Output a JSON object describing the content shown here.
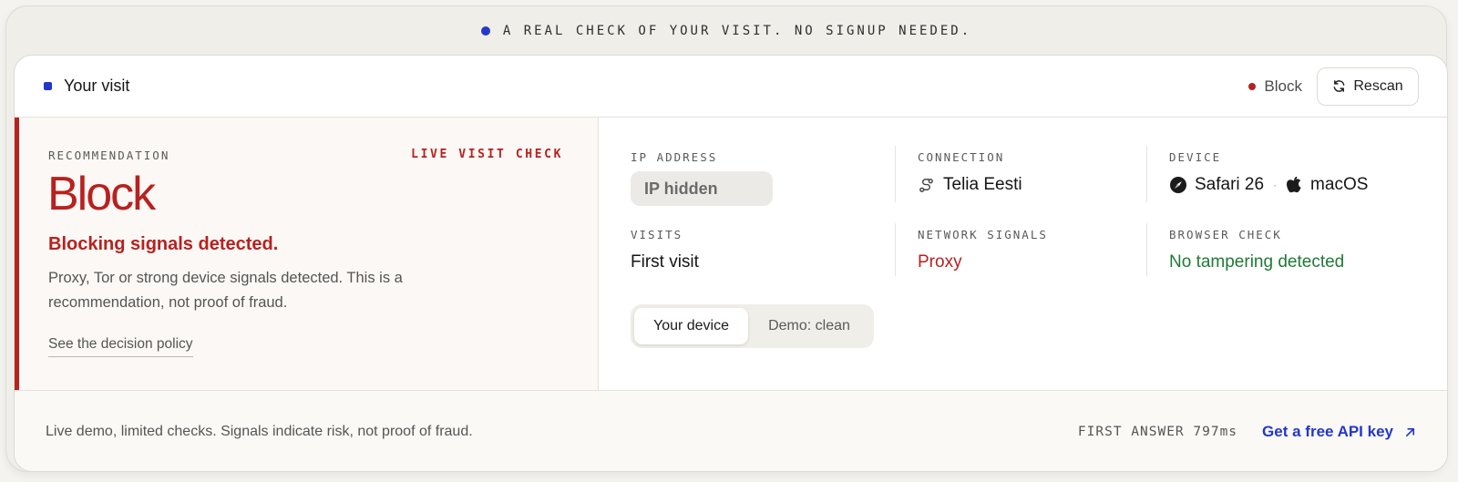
{
  "banner": {
    "text": "A REAL CHECK OF YOUR VISIT. NO SIGNUP NEEDED."
  },
  "header": {
    "title": "Your visit",
    "status_label": "Block",
    "rescan_label": "Rescan"
  },
  "recommendation": {
    "label": "RECOMMENDATION",
    "badge": "LIVE VISIT CHECK",
    "verdict": "Block",
    "headline": "Blocking signals detected.",
    "description": "Proxy, Tor or strong device signals detected. This is a recommendation, not proof of fraud.",
    "policy_link": "See the decision policy"
  },
  "details": {
    "ip": {
      "label": "IP ADDRESS",
      "value": "IP hidden"
    },
    "connection": {
      "label": "CONNECTION",
      "value": "Telia Eesti"
    },
    "device": {
      "label": "DEVICE",
      "browser": "Safari 26",
      "separator": "·",
      "os": "macOS"
    },
    "visits": {
      "label": "VISITS",
      "value": "First visit"
    },
    "network": {
      "label": "NETWORK SIGNALS",
      "value": "Proxy"
    },
    "browser_check": {
      "label": "BROWSER CHECK",
      "value": "No tampering detected"
    }
  },
  "toggle": {
    "options": [
      "Your device",
      "Demo: clean"
    ],
    "selected": "Your device"
  },
  "footer": {
    "note": "Live demo, limited checks. Signals indicate risk, not proof of fraud.",
    "first_answer": "FIRST ANSWER 797ms",
    "api_link": "Get a free API key"
  },
  "colors": {
    "accent_blue": "#2437c9",
    "block_red": "#b8211f",
    "ok_green": "#1f7a35"
  },
  "icons": {
    "rescan": "refresh-icon",
    "connection": "route-icon",
    "browser": "compass-icon",
    "os": "apple-icon",
    "api_link": "arrow-up-right-icon"
  }
}
